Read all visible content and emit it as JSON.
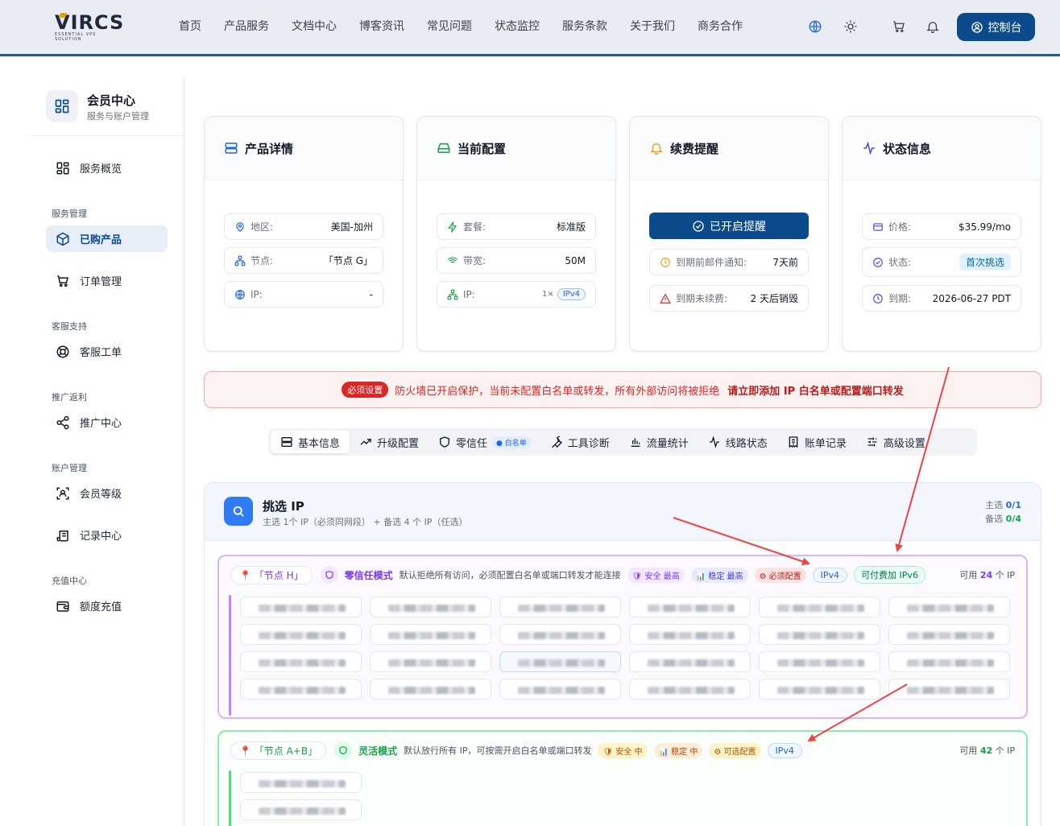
{
  "brand": {
    "logo_text": "VIRCS",
    "logo_tagline": "ESSENTIAL VPS SOLUTION",
    "accent": "#0b4a8b"
  },
  "nav": [
    "首页",
    "产品服务",
    "文档中心",
    "博客资讯",
    "常见问题",
    "状态监控",
    "服务条款",
    "关于我们",
    "商务合作"
  ],
  "header": {
    "console_label": "控制台",
    "icons": [
      "globe-icon",
      "sun-icon",
      "cart-icon",
      "bell-icon",
      "user-circle-icon"
    ]
  },
  "sidebar": {
    "title": "会员中心",
    "subtitle": "服务与账户管理",
    "overview": "服务概览",
    "groups": {
      "service": "服务管理",
      "support": "客服支持",
      "affiliate": "推广返利",
      "account": "账户管理",
      "recharge": "充值中心"
    },
    "items": {
      "purchased": "已购产品",
      "orders": "订单管理",
      "tickets": "客服工单",
      "promo": "推广中心",
      "level": "会员等级",
      "records": "记录中心",
      "topup": "额度充值"
    }
  },
  "cards": {
    "product": {
      "title": "产品详情",
      "region_label": "地区:",
      "region_value": "美国-加州",
      "node_label": "节点:",
      "node_value": "「节点 G」",
      "ip_label": "IP:",
      "ip_value": "-"
    },
    "config": {
      "title": "当前配置",
      "plan_label": "套餐:",
      "plan_value": "标准版",
      "bandwidth_label": "带宽:",
      "bandwidth_value": "50M",
      "ip_label": "IP:",
      "ip_count": "1×",
      "ip_type": "IPv4"
    },
    "renewal": {
      "title": "续费提醒",
      "button": "已开启提醒",
      "email_label": "到期前邮件通知:",
      "email_value": "7天前",
      "expire_label": "到期未续费:",
      "expire_value": "2 天后销毁"
    },
    "status": {
      "title": "状态信息",
      "price_label": "价格:",
      "price_value": "$35.99/mo",
      "state_label": "状态:",
      "state_value": "首次挑选",
      "due_label": "到期:",
      "due_value": "2026-06-27 PDT"
    }
  },
  "alert": {
    "tag": "必须设置",
    "message": "防火墙已开启保护，当前未配置白名单或转发，所有外部访问将被拒绝",
    "action": "请立即添加 IP 白名单或配置端口转发"
  },
  "tabs": [
    {
      "label": "基本信息",
      "icon": "server-icon"
    },
    {
      "label": "升级配置",
      "icon": "trend-up-icon"
    },
    {
      "label": "零信任",
      "icon": "shield-icon",
      "badge": "● 白名单"
    },
    {
      "label": "工具诊断",
      "icon": "wrench-icon"
    },
    {
      "label": "流量统计",
      "icon": "bar-chart-icon"
    },
    {
      "label": "线路状态",
      "icon": "activity-icon"
    },
    {
      "label": "账单记录",
      "icon": "receipt-icon"
    },
    {
      "label": "高级设置",
      "icon": "sliders-icon"
    }
  ],
  "ip_panel": {
    "title": "挑选 IP",
    "subtitle": "主选 1个 IP（必须同网段） + 备选 4 个 IP（任选）",
    "primary_label": "主选",
    "primary_value": "0/1",
    "backup_label": "备选",
    "backup_value": "0/4",
    "nodes": [
      {
        "name": "「节点 H」",
        "mode": "零信任模式",
        "desc": "默认拒绝所有访问，必须配置白名单或端口转发才能连接",
        "chips": [
          "🛡 安全 最高",
          "📊 稳定 最高",
          "⚙ 必须配置"
        ],
        "ipv4": "IPv4",
        "ipv6": "可付费加 IPv6",
        "avail_prefix": "可用",
        "avail_count": "24",
        "avail_suffix": "个 IP"
      },
      {
        "name": "「节点 A+B」",
        "mode": "灵活模式",
        "desc": "默认放行所有 IP，可按需开启白名单或端口转发",
        "chips": [
          "🛡 安全 中",
          "📊 稳定 中",
          "⚙ 可选配置"
        ],
        "ipv4": "IPv4",
        "avail_prefix": "可用",
        "avail_count": "42",
        "avail_suffix": "个 IP"
      }
    ]
  }
}
